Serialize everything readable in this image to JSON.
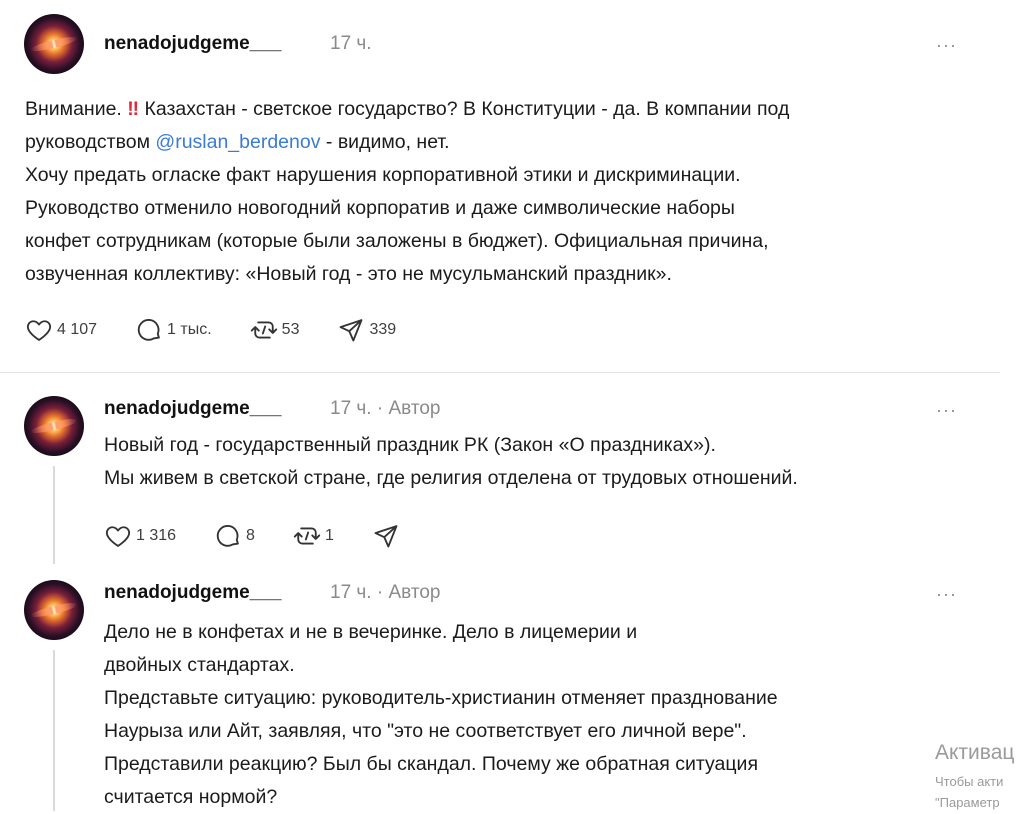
{
  "main_post": {
    "username": "nenadojudgeme___",
    "time": "17 ч.",
    "more": "···",
    "lines": [
      {
        "before": "Внимание. ",
        "warn": "‼",
        "after": " Казахстан - светское государство? В Конституции - да. В компании под"
      },
      {
        "before": "руководством ",
        "mention": "@ruslan_berdenov",
        "after": " - видимо, нет."
      },
      {
        "before": "Хочу предать огласке факт нарушения корпоративной этики и дискриминации."
      },
      {
        "before": "Руководство отменило новогодний корпоратив и даже символические наборы"
      },
      {
        "before": "конфет сотрудникам (которые были заложены в бюджет). Официальная причина,"
      },
      {
        "before": "озвученная коллективу: «Новый год - это не мусульманский праздник»."
      }
    ],
    "likes": "4 107",
    "replies": "1 тыс.",
    "reposts": "53",
    "shares": "339"
  },
  "reply1": {
    "username": "nenadojudgeme___",
    "time": "17 ч.",
    "author_tag": "· Автор",
    "more": "···",
    "lines": [
      "Новый год - государственный праздник РК (Закон «О праздниках»).",
      "Мы живем в светской стране, где религия отделена от трудовых отношений."
    ],
    "likes": "1 316",
    "replies": "8",
    "reposts": "1"
  },
  "reply2": {
    "username": "nenadojudgeme___",
    "time": "17 ч.",
    "author_tag": "· Автор",
    "more": "···",
    "lines": [
      "Дело не в конфетах и не в вечеринке. Дело в лицемерии и",
      "двойных стандартах.",
      "Представьте ситуацию: руководитель-христианин отменяет празднование",
      "Наурыза или Айт, заявляя, что \"это не соответствует его личной вере\".",
      "Представили реакцию? Был бы скандал. Почему же обратная ситуация",
      "считается нормой?"
    ]
  },
  "watermark": {
    "title": "Активац",
    "line1": "Чтобы акти",
    "line2": "\"Параметр"
  }
}
